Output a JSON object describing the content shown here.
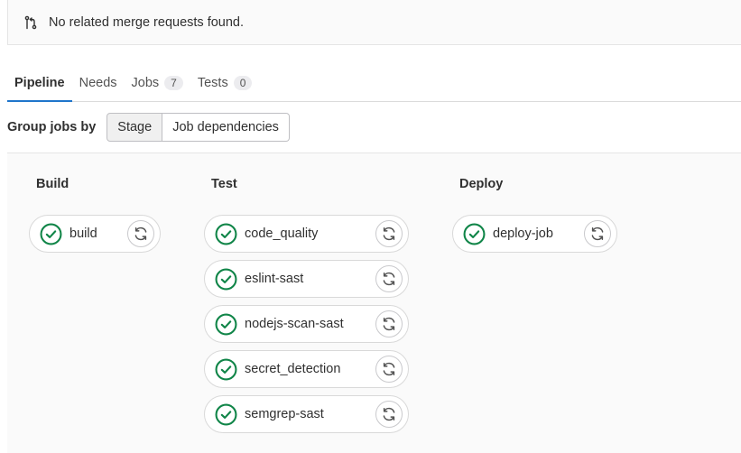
{
  "banner": {
    "icon": "merge-request-icon",
    "text": "No related merge requests found."
  },
  "tabs": [
    {
      "label": "Pipeline",
      "active": true
    },
    {
      "label": "Needs",
      "active": false
    },
    {
      "label": "Jobs",
      "count": "7",
      "active": false
    },
    {
      "label": "Tests",
      "count": "0",
      "active": false
    }
  ],
  "group_jobs": {
    "label": "Group jobs by",
    "options": [
      "Stage",
      "Job dependencies"
    ],
    "selected": "Stage"
  },
  "stages": [
    {
      "name": "Build",
      "jobs": [
        {
          "name": "build",
          "status": "passed"
        }
      ]
    },
    {
      "name": "Test",
      "jobs": [
        {
          "name": "code_quality",
          "status": "passed"
        },
        {
          "name": "eslint-sast",
          "status": "passed"
        },
        {
          "name": "nodejs-scan-sast",
          "status": "passed"
        },
        {
          "name": "secret_detection",
          "status": "passed"
        },
        {
          "name": "semgrep-sast",
          "status": "passed"
        }
      ]
    },
    {
      "name": "Deploy",
      "jobs": [
        {
          "name": "deploy-job",
          "status": "passed"
        }
      ]
    }
  ],
  "colors": {
    "success": "#108548",
    "active_tab_underline": "#1f75cb"
  }
}
